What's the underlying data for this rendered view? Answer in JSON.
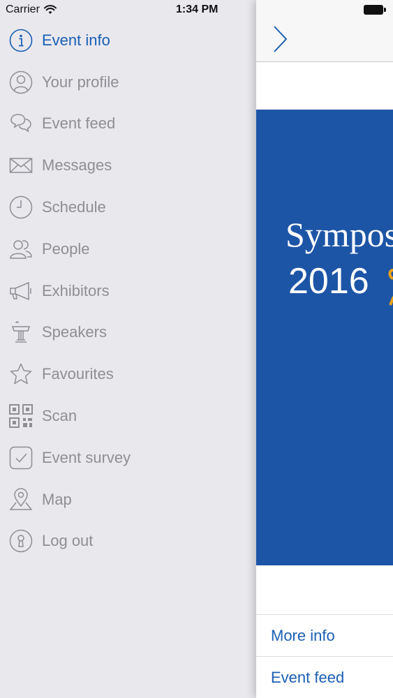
{
  "status_bar": {
    "carrier": "Carrier",
    "time": "1:34 PM"
  },
  "menu": {
    "items": [
      {
        "label": "Event info",
        "icon": "info-icon",
        "active": true
      },
      {
        "label": "Your profile",
        "icon": "profile-icon",
        "active": false
      },
      {
        "label": "Event feed",
        "icon": "chat-bubbles-icon",
        "active": false
      },
      {
        "label": "Messages",
        "icon": "envelope-icon",
        "active": false
      },
      {
        "label": "Schedule",
        "icon": "clock-icon",
        "active": false
      },
      {
        "label": "People",
        "icon": "people-icon",
        "active": false
      },
      {
        "label": "Exhibitors",
        "icon": "megaphone-icon",
        "active": false
      },
      {
        "label": "Speakers",
        "icon": "podium-icon",
        "active": false
      },
      {
        "label": "Favourites",
        "icon": "star-icon",
        "active": false
      },
      {
        "label": "Scan",
        "icon": "qr-code-icon",
        "active": false
      },
      {
        "label": "Event survey",
        "icon": "checkbox-icon",
        "active": false
      },
      {
        "label": "Map",
        "icon": "map-pin-icon",
        "active": false
      },
      {
        "label": "Log out",
        "icon": "keyhole-icon",
        "active": false
      }
    ]
  },
  "panel": {
    "banner_title": "Sympos",
    "banner_year": "2016",
    "links": [
      "More info",
      "Event feed"
    ]
  },
  "colors": {
    "accent": "#1a5fb4",
    "menu_text": "#8e8e93",
    "menu_bg": "#e9e8ed",
    "banner_bg": "#1d55a6",
    "banner_accent": "#e8a21a"
  }
}
